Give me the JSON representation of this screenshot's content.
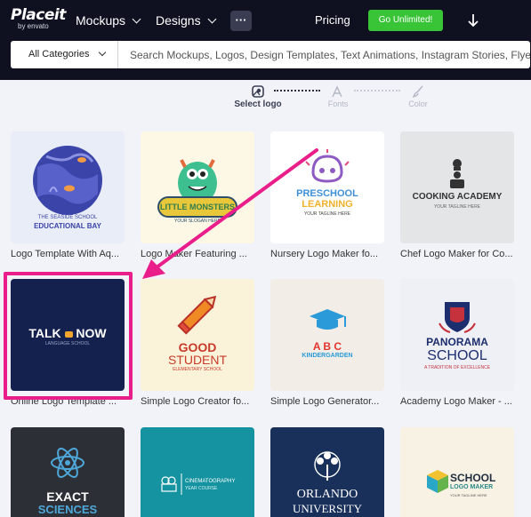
{
  "nav": {
    "logo": "Placeit",
    "logo_sub": "by envato",
    "mockups": "Mockups",
    "designs": "Designs",
    "more": "···",
    "pricing": "Pricing",
    "cta": "Go Unlimited!",
    "cta_color": "#39c437",
    "download_icon": "arrow-down-icon"
  },
  "search": {
    "category": "All Categories",
    "placeholder": "Search Mockups, Logos, Design Templates, Text Animations, Instagram Stories, Flyers..."
  },
  "steps": [
    {
      "label": "Select logo",
      "active": true,
      "icon": "logo-select-icon"
    },
    {
      "label": "Fonts",
      "active": false,
      "icon": "font-icon"
    },
    {
      "label": "Color",
      "active": false,
      "icon": "brush-icon"
    }
  ],
  "templates": [
    {
      "title": "Logo Template With Aq...",
      "art_text": "EDUCATIONAL BAY",
      "art_small": "THE SEASIDE SCHOOL"
    },
    {
      "title": "Logo Maker Featuring ...",
      "art_text": "LITTLE MONSTERS",
      "art_small": "YOUR SLOGAN HERE"
    },
    {
      "title": "Nursery Logo Maker fo...",
      "art_text": "PRESCHOOL",
      "art_text2": "LEARNING",
      "art_small": "YOUR TAGLINE HERE"
    },
    {
      "title": "Chef Logo Maker for Co...",
      "art_text": "COOKING ACADEMY",
      "art_small": "YOUR TAGLINE HERE"
    },
    {
      "title": "Online Logo Template ...",
      "art_text": "TALK",
      "art_text2": "NOW",
      "art_small": "LANGUAGE SCHOOL"
    },
    {
      "title": "Simple Logo Creator fo...",
      "art_text": "GOOD",
      "art_text2": "STUDENT",
      "art_small": "ELEMENTARY SCHOOL"
    },
    {
      "title": "Simple Logo Generator...",
      "art_text": "A B C",
      "art_text2": "KINDERGARDEN"
    },
    {
      "title": "Academy Logo Maker - ...",
      "art_text": "PANORAMA",
      "art_text2": "SCHOOL",
      "art_small": "A TRADITION OF EXCELLENCE"
    },
    {
      "title": "",
      "art_text": "EXACT",
      "art_text2": "SCIENCES"
    },
    {
      "title": "",
      "art_text": "CINEMATOGRAPHY",
      "art_small": "YEAR COURSE"
    },
    {
      "title": "",
      "art_text": "ORLANDO",
      "art_text2": "UNIVERSITY"
    },
    {
      "title": "",
      "art_text": "SCHOOL",
      "art_text2": "LOGO MAKER",
      "art_small": "YOUR TAGLINE HERE"
    }
  ],
  "colors": {
    "nav_bg": "#0f1121",
    "highlight": "#ea1e8a",
    "page_bg": "#f1f3f8"
  }
}
